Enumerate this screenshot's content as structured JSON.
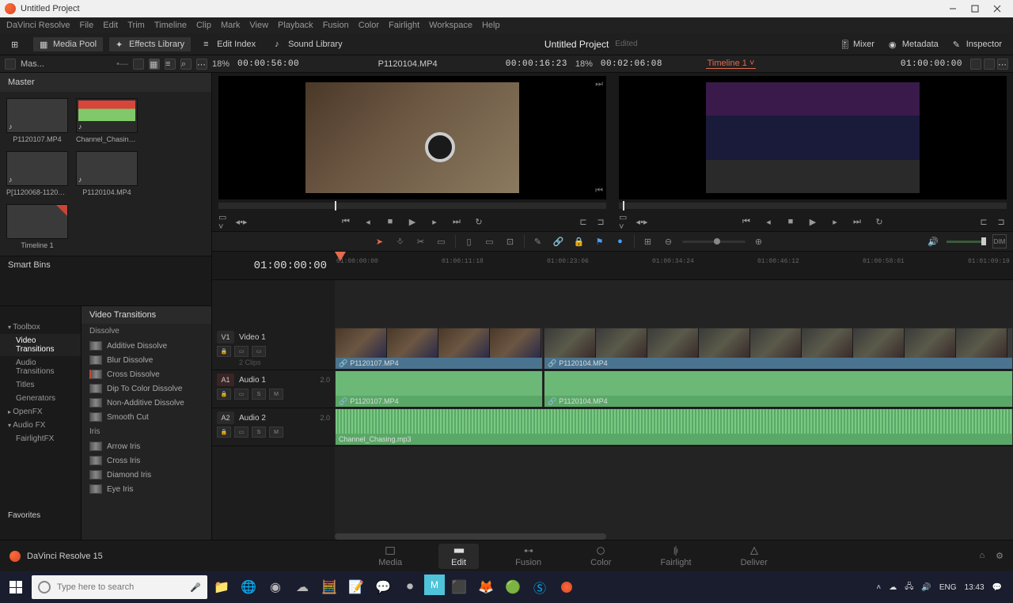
{
  "window": {
    "title": "Untitled Project"
  },
  "menu": [
    "DaVinci Resolve",
    "File",
    "Edit",
    "Trim",
    "Timeline",
    "Clip",
    "Mark",
    "View",
    "Playback",
    "Fusion",
    "Color",
    "Fairlight",
    "Workspace",
    "Help"
  ],
  "toolbar": {
    "media_pool": "Media Pool",
    "effects_library": "Effects Library",
    "edit_index": "Edit Index",
    "sound_library": "Sound Library",
    "project_title": "Untitled Project",
    "edited": "Edited",
    "mixer": "Mixer",
    "metadata": "Metadata",
    "inspector": "Inspector"
  },
  "subheader": {
    "breadcrumb": "Mas...",
    "src_percent": "18%",
    "src_tc": "00:00:56:00",
    "source_name": "P1120104.MP4",
    "src_dur": "00:00:16:23",
    "prog_percent": "18%",
    "prog_tc": "00:02:06:08",
    "timeline_name": "Timeline 1",
    "record_tc": "01:00:00:00"
  },
  "sidebar": {
    "master": "Master",
    "thumbs": [
      {
        "label": "P1120107.MP4",
        "type": "video"
      },
      {
        "label": "Channel_Chasing.mp3",
        "type": "audio"
      },
      {
        "label": "P[1120068-1120068]...",
        "type": "video"
      },
      {
        "label": "P1120104.MP4",
        "type": "video"
      },
      {
        "label": "Timeline 1",
        "type": "timeline"
      }
    ],
    "smartbins": "Smart Bins",
    "fx_nav": {
      "toolbox": "Toolbox",
      "items": [
        "Video Transitions",
        "Audio Transitions",
        "Titles",
        "Generators"
      ],
      "openfx": "OpenFX",
      "audiofx": "Audio FX",
      "fairlightfx": "FairlightFX"
    },
    "favorites": "Favorites",
    "fx_title": "Video Transitions",
    "fx_groups": [
      {
        "name": "Dissolve",
        "items": [
          "Additive Dissolve",
          "Blur Dissolve",
          "Cross Dissolve",
          "Dip To Color Dissolve",
          "Non-Additive Dissolve",
          "Smooth Cut"
        ],
        "marked": 2
      },
      {
        "name": "Iris",
        "items": [
          "Arrow Iris",
          "Cross Iris",
          "Diamond Iris",
          "Eye Iris"
        ]
      }
    ]
  },
  "timeline": {
    "tc": "01:00:00:00",
    "ruler": [
      "01:00:00:00",
      "01:00:11:18",
      "01:00:23:06",
      "01:00:34:24",
      "01:00:46:12",
      "01:00:58:01",
      "01:01:09:19"
    ],
    "tracks": {
      "v1": {
        "idx": "V1",
        "name": "Video 1",
        "clips_sub": "2 Clips"
      },
      "a1": {
        "idx": "A1",
        "name": "Audio 1",
        "ch": "2.0"
      },
      "a2": {
        "idx": "A2",
        "name": "Audio 2",
        "ch": "2.0"
      }
    },
    "clips": {
      "v1_a": "P1120107.MP4",
      "v1_b": "P1120104.MP4",
      "a1_a": "P1120107.MP4",
      "a1_b": "P1120104.MP4",
      "a2": "Channel_Chasing.mp3"
    }
  },
  "version": "DaVinci Resolve 15",
  "pages": [
    "Media",
    "Edit",
    "Fusion",
    "Color",
    "Fairlight",
    "Deliver"
  ],
  "taskbar": {
    "search_ph": "Type here to search",
    "lang": "ENG",
    "time": "13:43"
  }
}
